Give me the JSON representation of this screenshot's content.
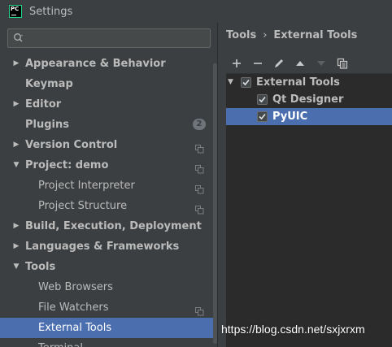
{
  "window": {
    "title": "Settings",
    "app_icon_text": "PC"
  },
  "search": {
    "value": "",
    "placeholder": ""
  },
  "sidebar": {
    "items": [
      {
        "label": "Appearance & Behavior",
        "expandable": true,
        "expanded": false,
        "level": 0,
        "bold": true
      },
      {
        "label": "Keymap",
        "expandable": false,
        "level": 0,
        "bold": true
      },
      {
        "label": "Editor",
        "expandable": true,
        "expanded": false,
        "level": 0,
        "bold": true
      },
      {
        "label": "Plugins",
        "expandable": false,
        "level": 0,
        "bold": true,
        "badge": "2"
      },
      {
        "label": "Version Control",
        "expandable": true,
        "expanded": false,
        "level": 0,
        "bold": true,
        "project_icon": true
      },
      {
        "label": "Project: demo",
        "expandable": true,
        "expanded": true,
        "level": 0,
        "bold": true,
        "project_icon": true
      },
      {
        "label": "Project Interpreter",
        "expandable": false,
        "level": 1,
        "bold": false,
        "project_icon": true
      },
      {
        "label": "Project Structure",
        "expandable": false,
        "level": 1,
        "bold": false,
        "project_icon": true
      },
      {
        "label": "Build, Execution, Deployment",
        "expandable": true,
        "expanded": false,
        "level": 0,
        "bold": true
      },
      {
        "label": "Languages & Frameworks",
        "expandable": true,
        "expanded": false,
        "level": 0,
        "bold": true
      },
      {
        "label": "Tools",
        "expandable": true,
        "expanded": true,
        "level": 0,
        "bold": true
      },
      {
        "label": "Web Browsers",
        "expandable": false,
        "level": 1,
        "bold": false
      },
      {
        "label": "File Watchers",
        "expandable": false,
        "level": 1,
        "bold": false,
        "project_icon": true
      },
      {
        "label": "External Tools",
        "expandable": false,
        "level": 1,
        "bold": false,
        "selected": true
      },
      {
        "label": "Terminal",
        "expandable": false,
        "level": 1,
        "bold": false,
        "project_icon": true
      }
    ]
  },
  "breadcrumb": {
    "parent": "Tools",
    "separator": "›",
    "current": "External Tools"
  },
  "toolbar": {
    "buttons": [
      "add-icon",
      "remove-icon",
      "edit-icon",
      "move-up-icon",
      "move-down-icon",
      "copy-icon"
    ]
  },
  "tools_tree": {
    "group": {
      "label": "External Tools",
      "checked": true,
      "expanded": true
    },
    "items": [
      {
        "label": "Qt Designer",
        "checked": true,
        "selected": false
      },
      {
        "label": "PyUIC",
        "checked": true,
        "selected": true
      }
    ]
  },
  "watermark": "https://blog.csdn.net/sxjxrxm",
  "colors": {
    "background": "#3c3f41",
    "panel_dark": "#2b2b2b",
    "selection": "#4b6eaf",
    "text": "#bbbbbb",
    "brand_green": "#21d789"
  }
}
